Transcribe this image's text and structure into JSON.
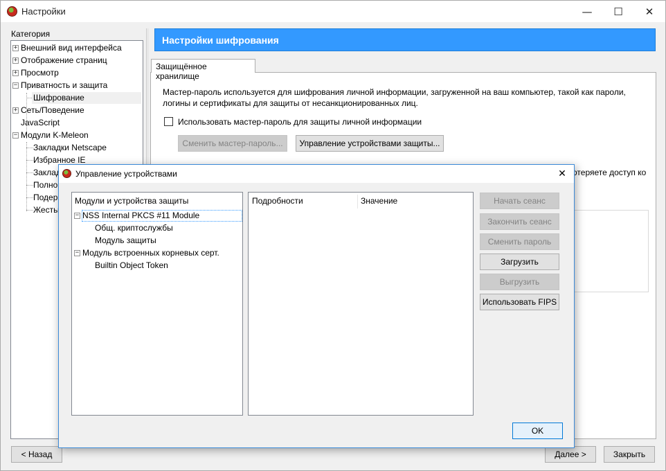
{
  "window": {
    "title": "Настройки",
    "minimize": "—",
    "maximize": "☐",
    "close": "✕"
  },
  "sidebar": {
    "category_label": "Категория",
    "items": [
      {
        "label": "Внешний вид интерфейса",
        "expander": "+"
      },
      {
        "label": "Отображение страниц",
        "expander": "+"
      },
      {
        "label": "Просмотр",
        "expander": "+"
      },
      {
        "label": "Приватность и защита",
        "expander": "−"
      },
      {
        "label": "Шифрование"
      },
      {
        "label": "Сеть/Поведение",
        "expander": "+"
      },
      {
        "label": "JavaScript"
      },
      {
        "label": "Модули K-Meleon",
        "expander": "−"
      },
      {
        "label": "Закладки Netscape"
      },
      {
        "label": "Избранное IE"
      },
      {
        "label": "Заклад"
      },
      {
        "label": "Полно"
      },
      {
        "label": "Подер"
      },
      {
        "label": "Жесты"
      }
    ]
  },
  "panel": {
    "header": "Настройки шифрования",
    "tab": "Защищённое хранилище",
    "description": "Мастер-пароль используется для шифрования личной информации, загруженной на ваш компьютер, такой как пароли, логины и сертификаты для защиты от несанкционированных лиц.",
    "checkbox_label": "Использовать мастер-пароль для защиты личной информации",
    "change_master_password": "Сменить мастер-пароль...",
    "manage_devices": "Управление устройствами защиты...",
    "partial_text": "отеряете доступ ко"
  },
  "footer": {
    "back": "< Назад",
    "next": "Далее >",
    "close": "Закрыть"
  },
  "dialog": {
    "title": "Управление устройствами",
    "close": "✕",
    "modules_header": "Модули и устройства защиты",
    "details_header": "Подробности",
    "value_header": "Значение",
    "tree": [
      {
        "label": "NSS Internal PKCS #11 Module",
        "expander": "−",
        "selected": true
      },
      {
        "label": "Общ. криптослужбы"
      },
      {
        "label": "Модуль защиты"
      },
      {
        "label": "Модуль встроенных корневых серт.",
        "expander": "−"
      },
      {
        "label": "Builtin Object Token"
      }
    ],
    "buttons": {
      "start_session": "Начать сеанс",
      "end_session": "Закончить сеанс",
      "change_password": "Сменить пароль",
      "load": "Загрузить",
      "unload": "Выгрузить",
      "fips": "Использовать FIPS"
    },
    "ok": "OK"
  },
  "colors": {
    "accent": "#3399ff",
    "focus": "#0078d7"
  }
}
